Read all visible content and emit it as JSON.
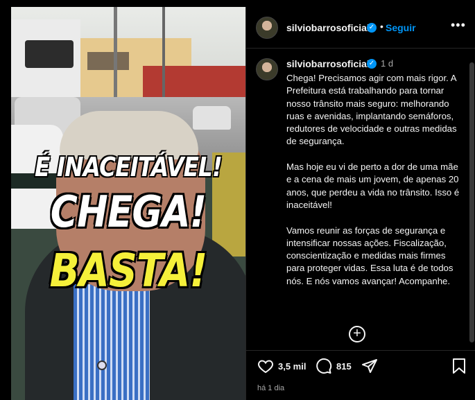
{
  "post": {
    "username": "silviobarrosoficial",
    "follow_label": "Seguir",
    "separator": "•",
    "more_label": "•••",
    "caption_time": "1 d",
    "caption": "Chega! Precisamos agir com mais rigor. A Prefeitura está trabalhando para tornar nosso trânsito mais seguro: melhorando ruas e avenidas, implantando semáforos, redutores de velocidade e outras medidas de segurança.\n\nMas hoje eu vi de perto a dor de uma mãe e a cena de mais um jovem, de apenas 20 anos, que perdeu a vida no trânsito. Isso é inaceitável!\n\nVamos reunir as forças de segurança e intensificar nossas ações. Fiscalização, conscientização e medidas mais firmes para proteger vidas. Essa luta é de todos nós. E nós vamos avançar! Acompanhe.",
    "likes": "3,5 mil",
    "comments": "815",
    "posted_ago": "há 1 dia"
  },
  "media": {
    "line1": "É INACEITÁVEL!",
    "line2": "CHEGA!",
    "line3": "BASTA!"
  },
  "icons": {
    "verified": "verified-badge-icon",
    "more": "more-options-icon",
    "like": "heart-icon",
    "comment": "comment-icon",
    "share": "share-icon",
    "save": "bookmark-icon",
    "add": "add-icon"
  },
  "colors": {
    "accent": "#0095f6",
    "background": "#000000",
    "text": "#f5f5f5",
    "muted": "#a8a8a8",
    "overlay_highlight": "#f5f03a"
  }
}
